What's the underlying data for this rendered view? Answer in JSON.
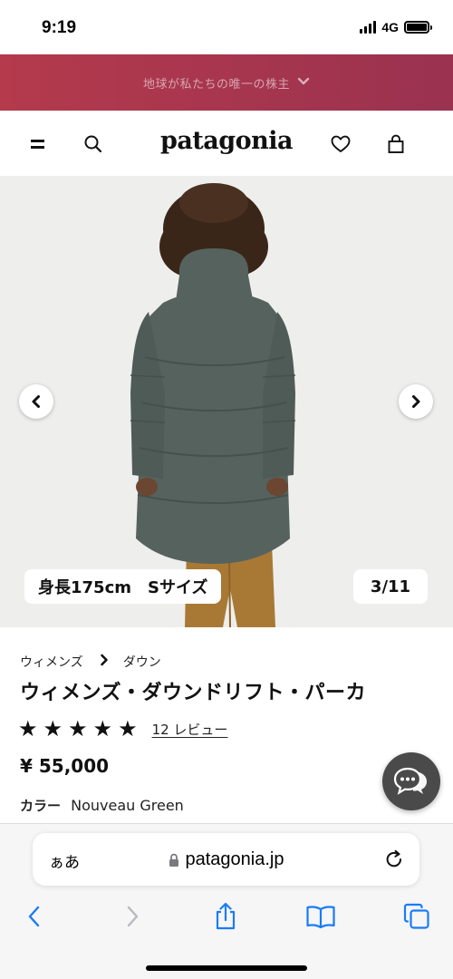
{
  "status_bar": {
    "time": "9:19",
    "network": "4G",
    "battery_level": 1.0
  },
  "promo_banner": {
    "text": "地球が私たちの唯一の株主",
    "chevron_icon": "chevron-down-icon"
  },
  "header": {
    "logo": "patagonia",
    "icons": [
      "menu-icon",
      "search-icon",
      "heart-icon",
      "bag-icon"
    ]
  },
  "gallery": {
    "size_caption": "身長175cm　Sサイズ",
    "counter": "3/11",
    "prev_icon": "chevron-left-icon",
    "next_icon": "chevron-right-icon",
    "image_colors": {
      "background": "#eeeeed",
      "jacket": "#56625e",
      "pants": "#a87935",
      "hair": "#3a2618"
    }
  },
  "product": {
    "breadcrumb": [
      "ウィメンズ",
      "ダウン"
    ],
    "title": "ウィメンズ・ダウンドリフト・パーカ",
    "rating": {
      "stars": 5,
      "max": 5
    },
    "reviews_label": "12 レビュー",
    "price": "¥ 55,000",
    "color_label": "カラー",
    "color_value": "Nouveau Green"
  },
  "chat": {
    "icon": "chat-bubbles-icon",
    "color": "#4a4a4a"
  },
  "browser": {
    "aa_label": "ぁあ",
    "url": "patagonia.jp",
    "toolbar_icons": [
      "back-icon",
      "forward-icon",
      "share-icon",
      "bookmarks-icon",
      "tabs-icon"
    ],
    "accent": "#1a7cf5"
  },
  "colors": {
    "banner_start": "#b43a4c",
    "banner_end": "#9a3250"
  }
}
